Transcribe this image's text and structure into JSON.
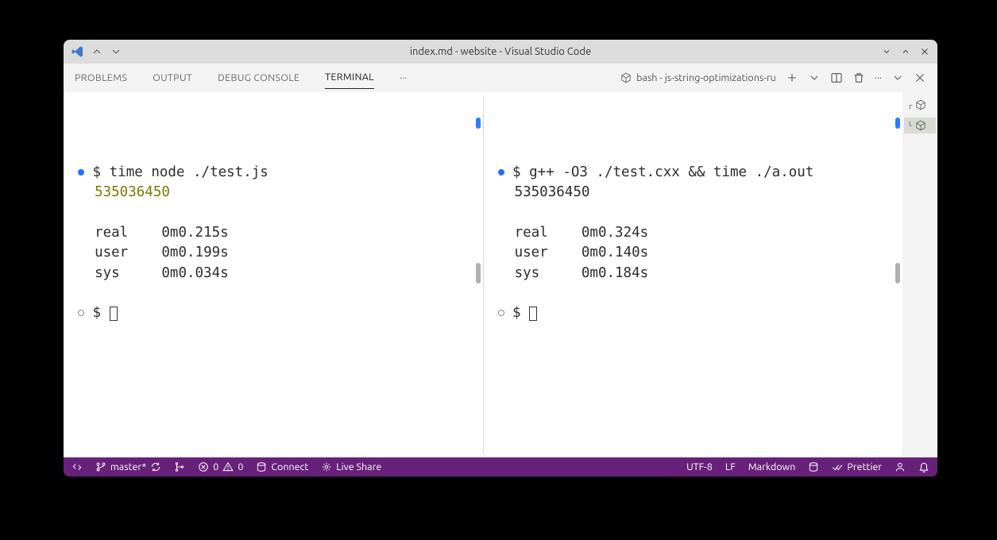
{
  "titlebar": {
    "title": "index.md - website - Visual Studio Code"
  },
  "panel": {
    "tabs": [
      "PROBLEMS",
      "OUTPUT",
      "DEBUG CONSOLE",
      "TERMINAL"
    ],
    "active_tab": "TERMINAL",
    "terminal_tab": "bash - js-string-optimizations-ru"
  },
  "terminals": {
    "left": {
      "command": "time node ./test.js",
      "output_value": "535036450",
      "real": "0m0.215s",
      "user": "0m0.199s",
      "sys": "0m0.034s"
    },
    "right": {
      "command": "g++ -O3 ./test.cxx && time ./a.out",
      "output_value": "535036450",
      "real": "0m0.324s",
      "user": "0m0.140s",
      "sys": "0m0.184s"
    },
    "prompt": "$",
    "time_labels": {
      "real": "real",
      "user": "user",
      "sys": "sys"
    }
  },
  "statusbar": {
    "branch": "master*",
    "errors": "0",
    "warnings": "0",
    "connect": "Connect",
    "live_share": "Live Share",
    "encoding": "UTF-8",
    "eol": "LF",
    "language": "Markdown",
    "prettier": "Prettier"
  }
}
